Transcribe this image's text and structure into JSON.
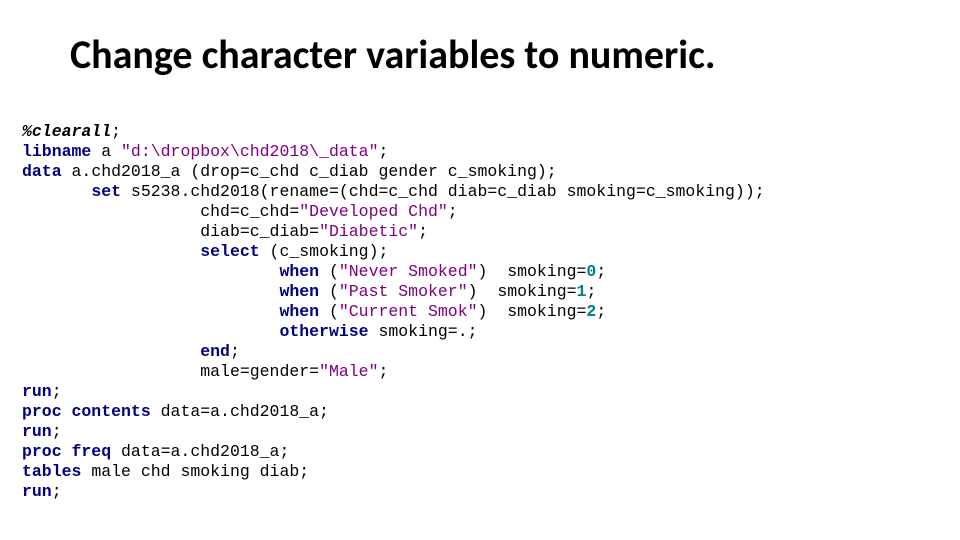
{
  "title": "Change character variables to numeric.",
  "code": {
    "macro_call": "%clearall",
    "semi": ";",
    "libname": {
      "kw": "libname",
      "rest": " a ",
      "str": "\"d:\\dropbox\\chd2018\\_data\""
    },
    "data": {
      "kw": "data",
      "rest": " a.chd2018_a (drop=c_chd c_diab gender c_smoking);"
    },
    "set_indent": "       ",
    "set": {
      "kw": "set",
      "rest": " s5238.chd2018(rename=(chd=c_chd diab=c_diab smoking=c_smoking));"
    },
    "block_indent": "                  ",
    "chd_line": {
      "pre": "chd=c_chd=",
      "str": "\"Developed Chd\"",
      "post": ";"
    },
    "diab_line": {
      "pre": "diab=c_diab=",
      "str": "\"Diabetic\"",
      "post": ";"
    },
    "select": {
      "kw": "select",
      "rest": " (c_smoking);"
    },
    "when_indent": "                          ",
    "when1": {
      "kw": "when",
      "pre": " (",
      "str": "\"Never Smoked\"",
      "post": ")  smoking=",
      "num": "0",
      "end": ";"
    },
    "when2": {
      "kw": "when",
      "pre": " (",
      "str": "\"Past Smoker\"",
      "post": ")  smoking=",
      "num": "1",
      "end": ";"
    },
    "when3": {
      "kw": "when",
      "pre": " (",
      "str": "\"Current Smok\"",
      "post": ")  smoking=",
      "num": "2",
      "end": ";"
    },
    "otherwise": {
      "kw": "otherwise",
      "rest": " smoking=.;"
    },
    "endkw": "end",
    "male_line": {
      "pre": "male=gender=",
      "str": "\"Male\"",
      "post": ";"
    },
    "run": "run",
    "proc_contents": {
      "kw": "proc contents",
      "rest": " data=a.chd2018_a;"
    },
    "proc_freq": {
      "kw": "proc freq",
      "rest": " data=a.chd2018_a;"
    },
    "tables": {
      "kw": "tables",
      "rest": " male chd smoking diab;"
    }
  }
}
